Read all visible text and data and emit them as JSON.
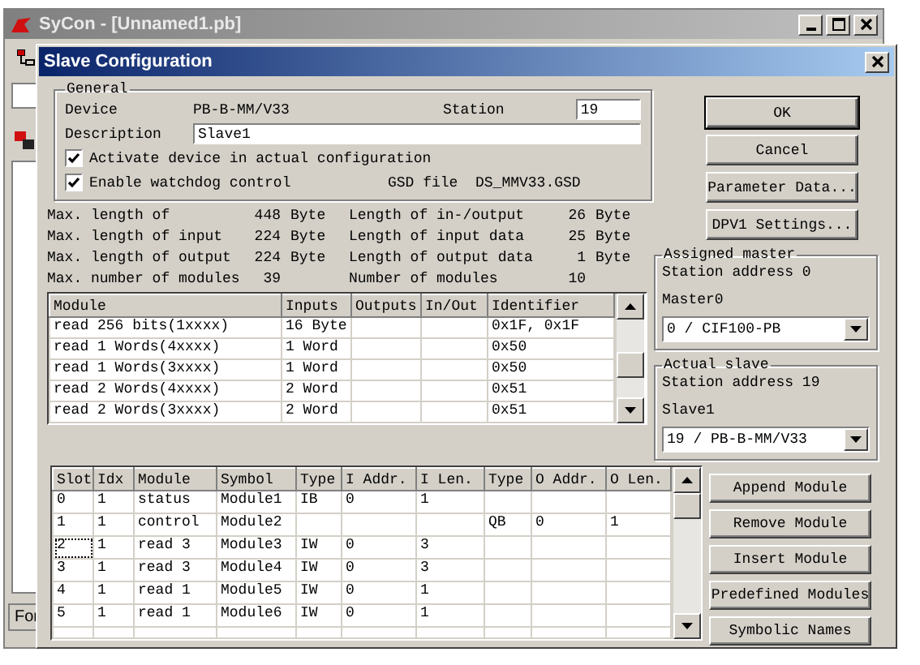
{
  "app_window": {
    "title": "SyCon - [Unnamed1.pb]",
    "status_tab": "For"
  },
  "dialog": {
    "title": "Slave Configuration"
  },
  "general": {
    "legend": "General",
    "device_label": "Device",
    "device": "PB-B-MM/V33",
    "station_label": "Station",
    "station": "19",
    "description_label": "Description",
    "description": "Slave1",
    "checkboxes": [
      {
        "label": "Activate device in actual configuration",
        "checked": true
      },
      {
        "label": "Enable watchdog control",
        "checked": true
      }
    ],
    "gsd_label": "GSD file",
    "gsd": "DS_MMV33.GSD"
  },
  "stats": [
    {
      "left": {
        "label": "Max. length of",
        "value": "448",
        "unit": "Byte"
      },
      "right": {
        "label": "Length of in-/output",
        "value": "26",
        "unit": "Byte"
      }
    },
    {
      "left": {
        "label": "Max. length of input",
        "value": "224",
        "unit": "Byte"
      },
      "right": {
        "label": "Length of input data",
        "value": "25",
        "unit": "Byte"
      }
    },
    {
      "left": {
        "label": "Max. length of output",
        "value": "224",
        "unit": "Byte"
      },
      "right": {
        "label": "Length of output data",
        "value": "1",
        "unit": "Byte"
      }
    },
    {
      "left": {
        "label": "Max. number of modules",
        "value": "39"
      },
      "right": {
        "label": "Number of modules",
        "value": "10"
      }
    }
  ],
  "module_table": {
    "columns": [
      "Module",
      "Inputs",
      "Outputs",
      "In/Out",
      "Identifier"
    ],
    "rows": [
      [
        "read 256 bits(1xxxx)",
        "16 Byte",
        null,
        null,
        "0x1F, 0x1F"
      ],
      [
        "read 1 Words(4xxxx)",
        "1 Word",
        null,
        null,
        "0x50"
      ],
      [
        "read 1 Words(3xxxx)",
        "1 Word",
        null,
        null,
        "0x50"
      ],
      [
        "read 2 Words(4xxxx)",
        "2 Word",
        null,
        null,
        "0x51"
      ],
      [
        "read 2 Words(3xxxx)",
        "2 Word",
        null,
        null,
        "0x51"
      ]
    ]
  },
  "buttons": [
    {
      "label": "OK",
      "default": true
    },
    {
      "label": "Cancel",
      "default": false
    },
    {
      "label": "Parameter Data...",
      "default": false
    },
    {
      "label": "DPV1 Settings...",
      "default": false
    }
  ],
  "assigned_master": {
    "legend": "Assigned master",
    "station_address": "Station address 0",
    "name": "Master0",
    "selection": "0 / CIF100-PB"
  },
  "actual_slave": {
    "legend": "Actual slave",
    "station_address": "Station address 19",
    "name": "Slave1",
    "selection": "19 / PB-B-MM/V33"
  },
  "slot_table": {
    "columns": [
      "Slot",
      "Idx",
      "Module",
      "Symbol",
      "Type",
      "I Addr.",
      "I Len.",
      "Type",
      "O Addr.",
      "O Len."
    ],
    "rows": [
      {
        "focused": false,
        "cells": [
          "0",
          "1",
          "status",
          "Module1",
          "IB",
          "0",
          "1",
          null,
          null,
          null
        ]
      },
      {
        "focused": false,
        "cells": [
          "1",
          "1",
          "control",
          "Module2",
          null,
          null,
          null,
          "QB",
          "0",
          "1"
        ]
      },
      {
        "focused": true,
        "cells": [
          "2",
          "1",
          "read 3",
          "Module3",
          "IW",
          "0",
          "3",
          null,
          null,
          null
        ]
      },
      {
        "focused": false,
        "cells": [
          "3",
          "1",
          "read 3",
          "Module4",
          "IW",
          "0",
          "3",
          null,
          null,
          null
        ]
      },
      {
        "focused": false,
        "cells": [
          "4",
          "1",
          "read 1",
          "Module5",
          "IW",
          "0",
          "1",
          null,
          null,
          null
        ]
      },
      {
        "focused": false,
        "cells": [
          "5",
          "1",
          "read 1",
          "Module6",
          "IW",
          "0",
          "1",
          null,
          null,
          null
        ]
      }
    ]
  },
  "module_buttons": [
    "Append Module",
    "Remove Module",
    "Insert Module",
    "Predefined Modules",
    "Symbolic Names"
  ]
}
